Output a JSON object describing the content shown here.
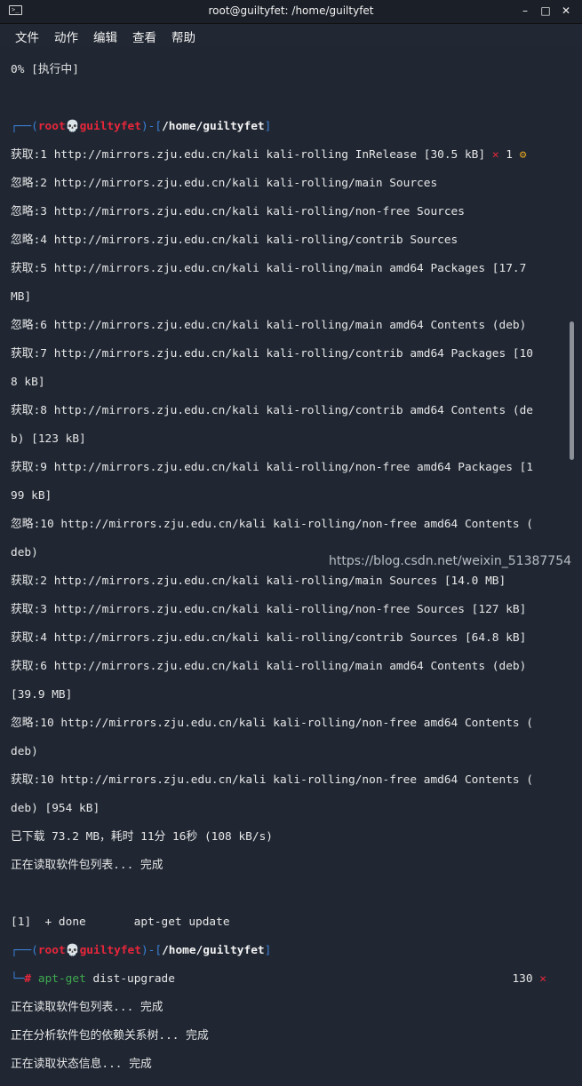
{
  "window": {
    "title": "root@guiltyfet: /home/guiltyfet",
    "buttons": {
      "minimize": "–",
      "maximize": "□",
      "close": "✕"
    }
  },
  "menu": [
    "文件",
    "动作",
    "编辑",
    "查看",
    "帮助"
  ],
  "prompt": {
    "bracket_open": "┌──(",
    "user": "root",
    "skull": "💀",
    "host": "guiltyfet",
    "mid": ")-[",
    "path": "/home/guiltyfet",
    "bracket_close": "]",
    "second_line_prefix": "└─",
    "hash": "#"
  },
  "lines": {
    "l0": "0% [执行中]",
    "l2_status_x": "✕",
    "l2_status_num": "1",
    "l2_status_gear": "⚙",
    "l3": "获取:1 http://mirrors.zju.edu.cn/kali kali-rolling InRelease [30.5 kB]",
    "l4": "忽略:2 http://mirrors.zju.edu.cn/kali kali-rolling/main Sources",
    "l5": "忽略:3 http://mirrors.zju.edu.cn/kali kali-rolling/non-free Sources",
    "l6": "忽略:4 http://mirrors.zju.edu.cn/kali kali-rolling/contrib Sources",
    "l7": "获取:5 http://mirrors.zju.edu.cn/kali kali-rolling/main amd64 Packages [17.7",
    "l8": "MB]",
    "l9": "忽略:6 http://mirrors.zju.edu.cn/kali kali-rolling/main amd64 Contents (deb)",
    "l10": "获取:7 http://mirrors.zju.edu.cn/kali kali-rolling/contrib amd64 Packages [10",
    "l11": "8 kB]",
    "l12": "获取:8 http://mirrors.zju.edu.cn/kali kali-rolling/contrib amd64 Contents (de",
    "l13": "b) [123 kB]",
    "l14": "获取:9 http://mirrors.zju.edu.cn/kali kali-rolling/non-free amd64 Packages [1",
    "l15": "99 kB]",
    "l16": "忽略:10 http://mirrors.zju.edu.cn/kali kali-rolling/non-free amd64 Contents (",
    "l17": "deb)",
    "l18": "获取:2 http://mirrors.zju.edu.cn/kali kali-rolling/main Sources [14.0 MB]",
    "l19": "获取:3 http://mirrors.zju.edu.cn/kali kali-rolling/non-free Sources [127 kB]",
    "l20": "获取:4 http://mirrors.zju.edu.cn/kali kali-rolling/contrib Sources [64.8 kB]",
    "l21": "获取:6 http://mirrors.zju.edu.cn/kali kali-rolling/main amd64 Contents (deb)",
    "l22": "[39.9 MB]",
    "l23": "忽略:10 http://mirrors.zju.edu.cn/kali kali-rolling/non-free amd64 Contents (",
    "l24": "deb)",
    "l25": "获取:10 http://mirrors.zju.edu.cn/kali kali-rolling/non-free amd64 Contents (",
    "l26": "deb) [954 kB]",
    "l27": "已下载 73.2 MB，耗时 11分 16秒 (108 kB/s)",
    "l28": "正在读取软件包列表... 完成",
    "l30": "[1]  + done       apt-get update",
    "cmd_word": "apt-get",
    "cmd_args": " dist-upgrade",
    "exit_code": "130",
    "exit_x": "✕",
    "l34": "正在读取软件包列表... 完成",
    "l35": "正在分析软件包的依赖关系树... 完成",
    "l36": "正在读取状态信息... 完成"
  },
  "watermark": "https://blog.csdn.net/weixin_51387754"
}
